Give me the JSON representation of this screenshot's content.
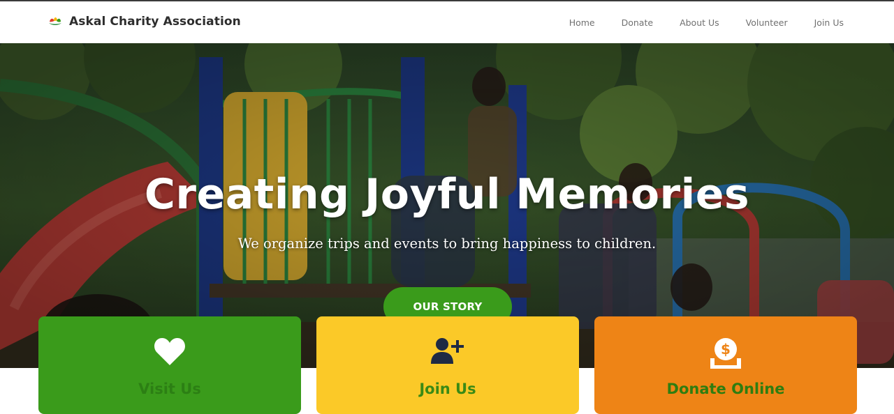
{
  "brand": {
    "name": "Askal Charity Association",
    "logo_icon": "leaf-logo-icon"
  },
  "nav": {
    "links": [
      {
        "label": "Home"
      },
      {
        "label": "Donate"
      },
      {
        "label": "About Us"
      },
      {
        "label": "Volunteer"
      },
      {
        "label": "Join Us"
      }
    ]
  },
  "hero": {
    "title": "Creating Joyful Memories",
    "subtitle": "We organize trips and events to bring happiness to children.",
    "button_label": "OUR STORY",
    "button_color": "#3a9b1b"
  },
  "cards": [
    {
      "label": "Visit Us",
      "icon": "heart-icon",
      "color": "#3a9b1b"
    },
    {
      "label": "Join Us",
      "icon": "add-user-icon",
      "color": "#fbc928"
    },
    {
      "label": "Donate Online",
      "icon": "donate-icon",
      "color": "#ee8416"
    }
  ]
}
